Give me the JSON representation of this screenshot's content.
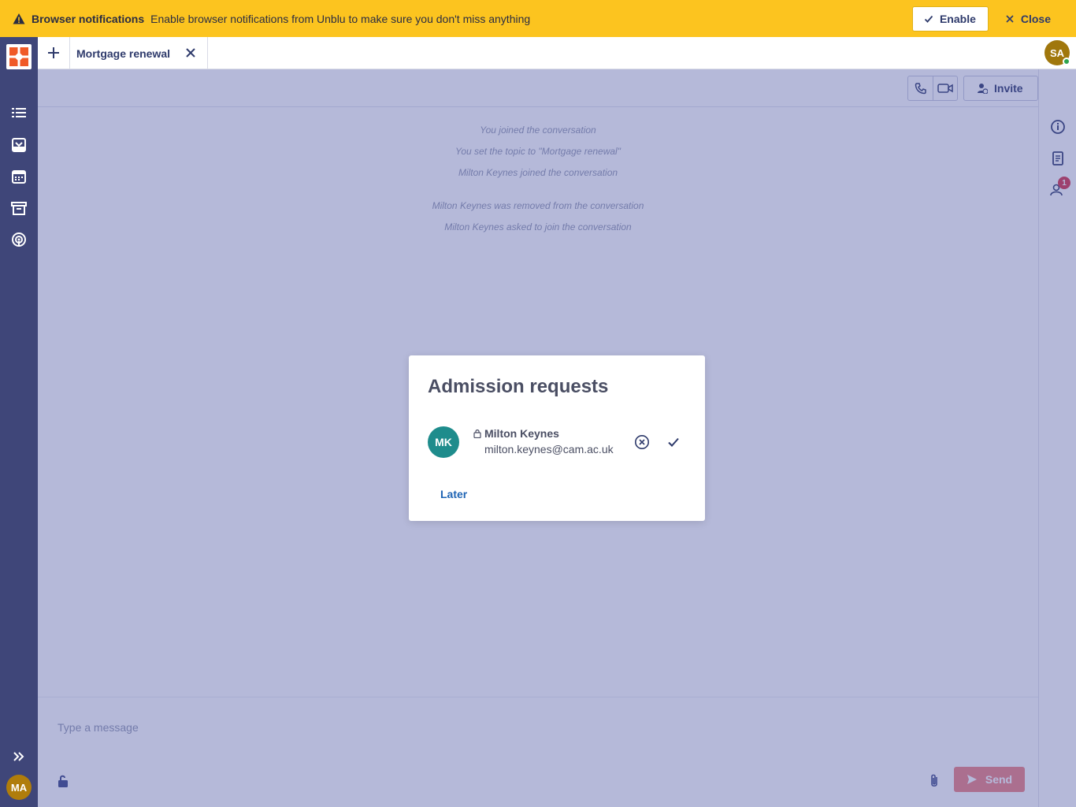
{
  "banner": {
    "title": "Browser notifications",
    "message": "Enable browser notifications from Unblu to make sure you don't miss anything",
    "enable_label": "Enable",
    "close_label": "Close",
    "background_color": "#fcc41f"
  },
  "sidebar": {
    "items": [
      {
        "icon": "list-icon"
      },
      {
        "icon": "inbox-icon"
      },
      {
        "icon": "calendar-icon"
      },
      {
        "icon": "archive-icon"
      },
      {
        "icon": "broadcast-icon"
      }
    ],
    "expand_icon": "double-chevron-right-icon",
    "user_initials": "MA",
    "background_color": "#3f4679"
  },
  "tabs": {
    "active_tab": "Mortgage renewal",
    "user_initials": "SA"
  },
  "toolbar": {
    "invite_label": "Invite"
  },
  "events": [
    "You joined the conversation",
    "You set the topic to \"Mortgage renewal\"",
    "Milton Keynes joined the conversation",
    "Milton Keynes was removed from the conversation",
    "Milton Keynes asked to join the conversation"
  ],
  "composer": {
    "placeholder": "Type a message",
    "send_label": "Send"
  },
  "rightpanel": {
    "participants_badge": "1"
  },
  "modal": {
    "title": "Admission requests",
    "request": {
      "initials": "MK",
      "name": "Milton Keynes",
      "email": "milton.keynes@cam.ac.uk"
    },
    "later_label": "Later",
    "accent_color": "#1e64b4"
  }
}
